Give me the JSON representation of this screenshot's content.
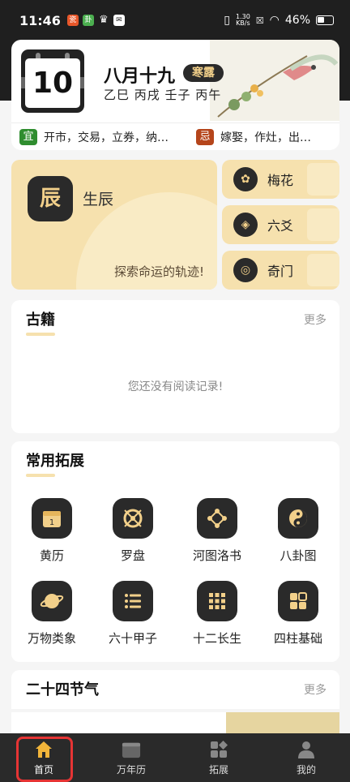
{
  "status_bar": {
    "time": "11:46",
    "net_speed": "1.30\nKB/s",
    "battery": "46%"
  },
  "date_card": {
    "day": "10",
    "lunar_date": "八月十九",
    "solar_term": "寒露",
    "ganzhi": "乙巳 丙戌 壬子 丙午",
    "yi_label": "宜",
    "yi_text": "开市，交易，立券，纳…",
    "ji_label": "忌",
    "ji_text": "嫁娶，作灶，出…"
  },
  "features": {
    "main_icon": "生辰-icon",
    "main_icon_char": "辰",
    "main_label": "生辰",
    "main_tagline": "探索命运的轨迹!",
    "side": [
      {
        "label": "梅花",
        "icon": "plum-blossom-icon"
      },
      {
        "label": "六爻",
        "icon": "coin-icon"
      },
      {
        "label": "奇门",
        "icon": "compass-icon"
      }
    ]
  },
  "books": {
    "title": "古籍",
    "more": "更多",
    "empty_text": "您还没有阅读记录!"
  },
  "extensions": {
    "title": "常用拓展",
    "items": [
      {
        "label": "黄历",
        "icon": "calendar-icon"
      },
      {
        "label": "罗盘",
        "icon": "compass-icon"
      },
      {
        "label": "河图洛书",
        "icon": "hetu-diagram-icon"
      },
      {
        "label": "八卦图",
        "icon": "yinyang-icon"
      },
      {
        "label": "万物类象",
        "icon": "planet-icon"
      },
      {
        "label": "六十甲子",
        "icon": "list-icon"
      },
      {
        "label": "十二长生",
        "icon": "grid-icon"
      },
      {
        "label": "四柱基础",
        "icon": "pillars-icon"
      }
    ]
  },
  "solar_terms": {
    "title": "二十四节气",
    "more": "更多"
  },
  "bottom_nav": {
    "items": [
      {
        "label": "首页",
        "icon": "home-icon",
        "active": true
      },
      {
        "label": "万年历",
        "icon": "calendar-icon",
        "active": false
      },
      {
        "label": "拓展",
        "icon": "apps-icon",
        "active": false
      },
      {
        "label": "我的",
        "icon": "user-icon",
        "active": false
      }
    ]
  },
  "colors": {
    "accent_gold": "#f6e1ae",
    "dark": "#2a2a2a",
    "yi_green": "#2f8d2f",
    "ji_orange": "#b5451b",
    "active_outline": "#e63434"
  }
}
